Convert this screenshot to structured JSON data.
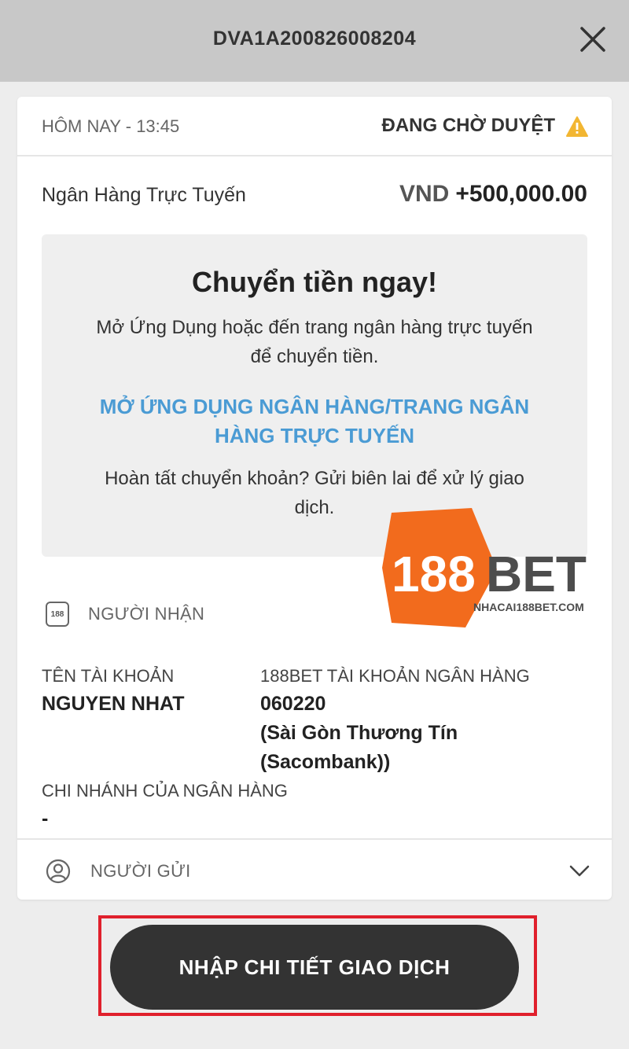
{
  "header": {
    "title": "DVA1A200826008204"
  },
  "status": {
    "date": "HÔM NAY - 13:45",
    "label": "ĐANG CHỜ DUYỆT",
    "color": "#f2b632"
  },
  "transaction": {
    "method": "Ngân Hàng Trực Tuyến",
    "currency": "VND",
    "amount": "+500,000.00"
  },
  "instructions": {
    "title": "Chuyển tiền ngay!",
    "line1": "Mở Ứng Dụng hoặc đến trang ngân hàng trực tuyến",
    "line2": "để chuyển tiền.",
    "link_line1": "MỞ ỨNG DỤNG NGÂN HÀNG/TRANG NGÂN",
    "link_line2": "HÀNG TRỰC TUYẾN",
    "note_line1": "Hoàn tất chuyển khoản? Gửi biên lai để xử lý giao",
    "note_line2": "dịch.",
    "link_color": "#4a9bd4"
  },
  "recipient": {
    "section_label": "NGƯỜI NHẬN",
    "icon_text": "188",
    "account_name_label": "TÊN TÀI KHOẢN",
    "account_name": "NGUYEN NHAT",
    "bank_account_label": "188BET TÀI KHOẢN NGÂN HÀNG",
    "account_number": "060220",
    "bank_name_line1": "(Sài Gòn Thương Tín",
    "bank_name_line2": "(Sacombank))",
    "branch_label": "CHI NHÁNH CỦA NGÂN HÀNG",
    "branch_value": "-"
  },
  "sender": {
    "section_label": "NGƯỜI GỬI"
  },
  "watermark": {
    "number": "188",
    "word": "BET",
    "site": "NHACAI188BET.COM",
    "brand_color": "#f26b1d"
  },
  "action": {
    "primary_label": "NHẬP CHI TIẾT GIAO DỊCH",
    "highlight_color": "#e0202c"
  },
  "icons": [
    "close-icon",
    "warning-icon",
    "bank-icon",
    "user-icon",
    "chevron-down-icon"
  ]
}
